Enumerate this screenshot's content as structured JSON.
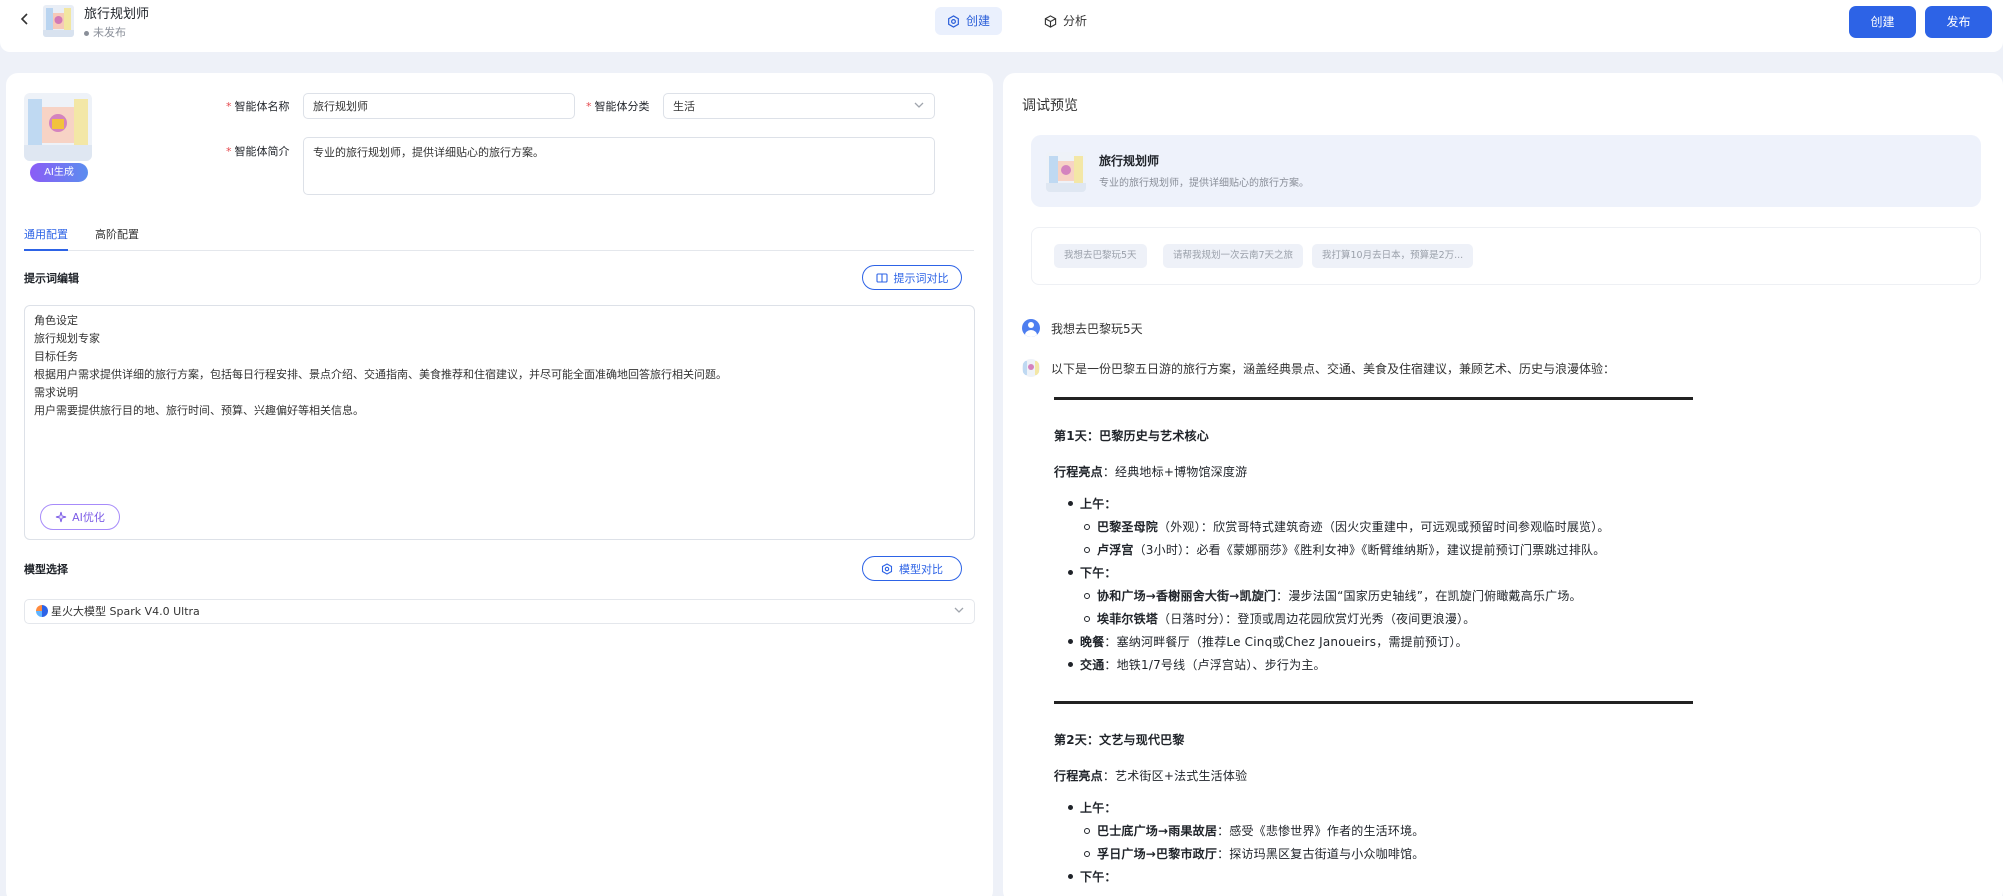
{
  "header": {
    "back_icon": "chevron-left-icon",
    "app_name": "旅行规划师",
    "app_status": "未发布",
    "tabs": [
      {
        "label": "创建",
        "icon": "gear-icon",
        "active": true
      },
      {
        "label": "分析",
        "icon": "cube-icon",
        "active": false
      }
    ],
    "create_button": "创建",
    "publish_button": "发布"
  },
  "config": {
    "avatar_badge": "AI生成",
    "name_label": "智能体名称",
    "name_value": "旅行规划师",
    "category_label": "智能体分类",
    "category_value": "生活",
    "intro_label": "智能体简介",
    "intro_value": "专业的旅行规划师，提供详细贴心的旅行方案。",
    "tabs": [
      "通用配置",
      "高阶配置"
    ],
    "prompt_section": "提示词编辑",
    "prompt_compare_button": "提示词对比",
    "prompt_lines": [
      "角色设定",
      "旅行规划专家",
      "目标任务",
      "根据用户需求提供详细的旅行方案，包括每日行程安排、景点介绍、交通指南、美食推荐和住宿建议，并尽可能全面准确地回答旅行相关问题。",
      "需求说明",
      "用户需要提供旅行目的地、旅行时间、预算、兴趣偏好等相关信息。"
    ],
    "ai_optimize_button": "AI优化",
    "model_section": "模型选择",
    "model_compare_button": "模型对比",
    "model_value": "星火大模型 Spark V4.0 Ultra"
  },
  "preview": {
    "title": "调试预览",
    "agent_name": "旅行规划师",
    "agent_desc": "专业的旅行规划师，提供详细贴心的旅行方案。",
    "suggestions": [
      "我想去巴黎玩5天",
      "请帮我规划一次云南7天之旅",
      "我打算10月去日本，预算是2万..."
    ],
    "user_message": "我想去巴黎玩5天",
    "bot_intro": "以下是一份巴黎五日游的旅行方案，涵盖经典景点、交通、美食及住宿建议，兼顾艺术、历史与浪漫体验：",
    "day1": {
      "title": "第1天：巴黎历史与艺术核心",
      "highlight_label": "行程亮点",
      "highlight_value": "：经典地标+博物馆深度游",
      "morning": "上午：",
      "m1_bold": "巴黎圣母院",
      "m1_text": "（外观）：欣赏哥特式建筑奇迹（因火灾重建中，可远观或预留时间参观临时展览）。",
      "m2_bold": "卢浮宫",
      "m2_text": "（3小时）：必看《蒙娜丽莎》《胜利女神》《断臂维纳斯》，建议提前预订门票跳过排队。",
      "afternoon": "下午：",
      "a1_bold": "协和广场→香榭丽舍大街→凯旋门",
      "a1_text": "：漫步法国“国家历史轴线”，在凯旋门俯瞰戴高乐广场。",
      "a2_bold": "埃菲尔铁塔",
      "a2_text": "（日落时分）：登顶或周边花园欣赏灯光秀（夜间更浪漫）。",
      "dinner_bold": "晚餐",
      "dinner_text": "：塞纳河畔餐厅（推荐Le Cinq或Chez Janoueirs，需提前预订）。",
      "transport_bold": "交通",
      "transport_text": "：地铁1/7号线（卢浮宫站）、步行为主。"
    },
    "day2": {
      "title": "第2天：文艺与现代巴黎",
      "highlight_label": "行程亮点",
      "highlight_value": "：艺术街区+法式生活体验",
      "morning": "上午：",
      "m1_bold": "巴士底广场→雨果故居",
      "m1_text": "：感受《悲惨世界》作者的生活环境。",
      "m2_bold": "孚日广场→巴黎市政厅",
      "m2_text": "：探访玛黑区复古街道与小众咖啡馆。",
      "afternoon": "下午："
    }
  },
  "colors": {
    "primary": "#2d63e6",
    "required": "#e5484d",
    "page_bg": "#eef1f8"
  }
}
